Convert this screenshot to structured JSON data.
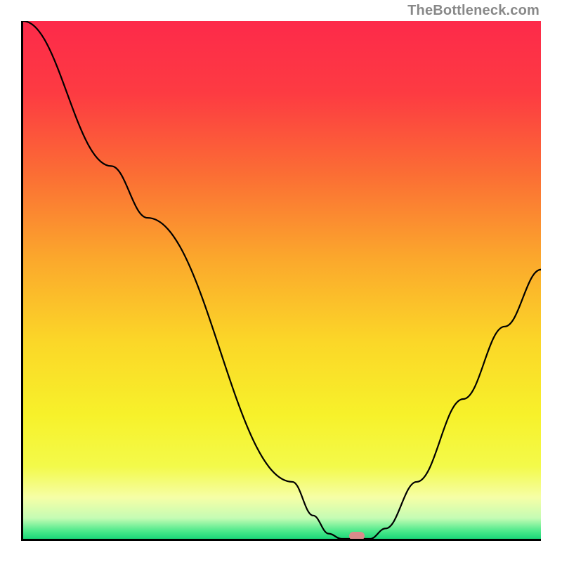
{
  "watermark": "TheBottleneck.com",
  "marker": {
    "color": "#d98b8b",
    "x_pct": 64.5,
    "y_pct": 99.4
  },
  "chart_data": {
    "type": "line",
    "title": "",
    "xlabel": "",
    "ylabel": "",
    "xlim": [
      0,
      100
    ],
    "ylim": [
      0,
      100
    ],
    "gradient_stops": [
      {
        "pct": 0,
        "color": "#fd2a4a"
      },
      {
        "pct": 14,
        "color": "#fd3b42"
      },
      {
        "pct": 30,
        "color": "#fb6f34"
      },
      {
        "pct": 46,
        "color": "#fba82c"
      },
      {
        "pct": 62,
        "color": "#fbd728"
      },
      {
        "pct": 76,
        "color": "#f7f12a"
      },
      {
        "pct": 86,
        "color": "#f3fa4a"
      },
      {
        "pct": 92,
        "color": "#f6fea6"
      },
      {
        "pct": 96,
        "color": "#c5fcb4"
      },
      {
        "pct": 98.5,
        "color": "#4ce98b"
      },
      {
        "pct": 100,
        "color": "#1bd679"
      }
    ],
    "series": [
      {
        "name": "bottleneck-curve",
        "points": [
          {
            "x": 0.0,
            "y": 100.0
          },
          {
            "x": 17.0,
            "y": 72.0
          },
          {
            "x": 24.0,
            "y": 62.0
          },
          {
            "x": 52.0,
            "y": 11.0
          },
          {
            "x": 56.0,
            "y": 4.5
          },
          {
            "x": 59.0,
            "y": 1.0
          },
          {
            "x": 61.5,
            "y": 0.0
          },
          {
            "x": 67.0,
            "y": 0.0
          },
          {
            "x": 70.0,
            "y": 2.0
          },
          {
            "x": 76.0,
            "y": 11.0
          },
          {
            "x": 85.0,
            "y": 27.0
          },
          {
            "x": 93.0,
            "y": 41.0
          },
          {
            "x": 100.0,
            "y": 52.0
          }
        ]
      }
    ]
  }
}
